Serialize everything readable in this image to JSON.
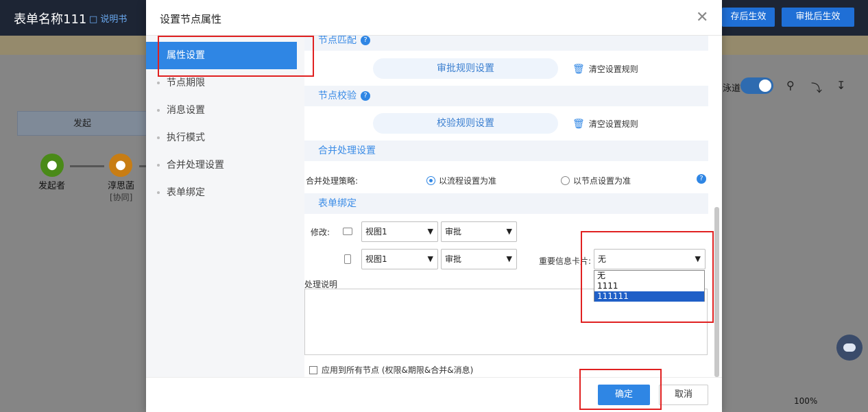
{
  "background": {
    "title": "表单名称111",
    "help_link": "说明书",
    "btn_save_effective": "存后生效",
    "btn_approve_effective": "审批后生效",
    "lane_label": "发起",
    "node1_label": "发起者",
    "node2_label": "淳思菡",
    "node2_sub": "[协同]",
    "toggle_label": "泳道",
    "zoom": "100%"
  },
  "modal": {
    "title": "设置节点属性",
    "sidebar": [
      {
        "label": "属性设置",
        "active": true
      },
      {
        "label": "节点期限"
      },
      {
        "label": "消息设置"
      },
      {
        "label": "执行模式"
      },
      {
        "label": "合并处理设置"
      },
      {
        "label": "表单绑定"
      }
    ],
    "node_match": {
      "title": "节点匹配",
      "rule_button": "审批规则设置",
      "clear_label": "清空设置规则"
    },
    "node_check": {
      "title": "节点校验",
      "rule_button": "校验规则设置",
      "clear_label": "清空设置规则"
    },
    "merge": {
      "title": "合并处理设置",
      "strategy_label": "合并处理策略:",
      "option1": "以流程设置为准",
      "option2": "以节点设置为准",
      "selected": "option1"
    },
    "form_bind": {
      "title": "表单绑定",
      "modify_label": "修改:",
      "pc_view": "视图1",
      "pc_mode": "审批",
      "mobile_view": "视图1",
      "mobile_mode": "审批",
      "card_label": "重要信息卡片:",
      "card_value": "无",
      "card_options": [
        "无",
        "1111",
        "111111"
      ],
      "card_highlighted": "111111"
    },
    "note_label": "处理说明",
    "apply_all": "应用到所有节点 (权限&期限&合并&消息)",
    "ok": "确定",
    "cancel": "取消"
  },
  "colors": {
    "accent": "#2f86e4",
    "header": "#1d2534",
    "highlight": "#e02020"
  }
}
